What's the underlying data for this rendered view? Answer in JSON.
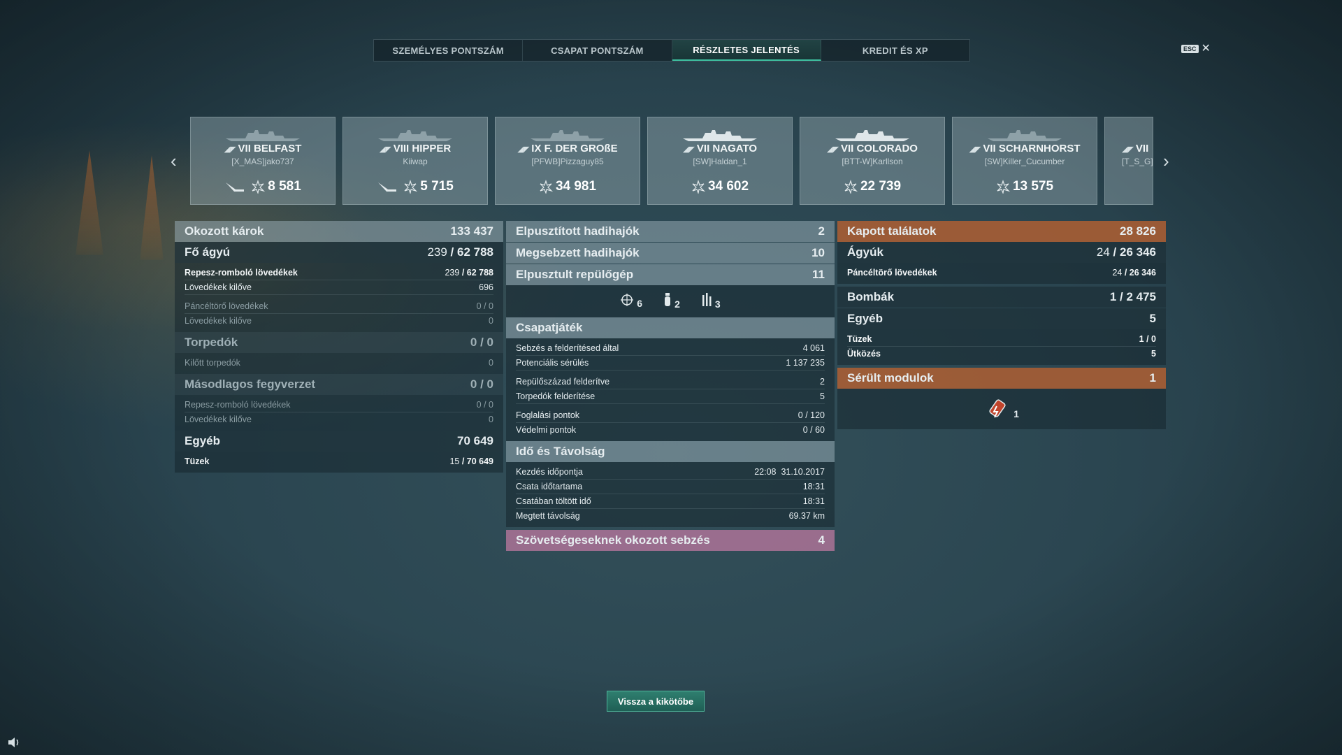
{
  "tabs": [
    {
      "label": "SZEMÉLYES PONTSZÁM"
    },
    {
      "label": "CSAPAT PONTSZÁM"
    },
    {
      "label": "RÉSZLETES JELENTÉS"
    },
    {
      "label": "KREDIT ÉS XP"
    }
  ],
  "esc": {
    "key": "ESC",
    "close": "✕"
  },
  "nav": {
    "prev": "‹",
    "next": "›"
  },
  "cards": [
    {
      "tier_name": "VII BELFAST",
      "player": "[X_MAS]jako737",
      "score": "8 581",
      "extra_icon": "plane-icon"
    },
    {
      "tier_name": "VIII HIPPER",
      "player": "Kiiwap",
      "score": "5 715",
      "extra_icon": "plane-icon"
    },
    {
      "tier_name": "IX F. DER GROßE",
      "player": "[PFWB]Pizzaguy85",
      "score": "34 981"
    },
    {
      "tier_name": "VII NAGATO",
      "player": "[SW]Haldan_1",
      "score": "34 602"
    },
    {
      "tier_name": "VII COLORADO",
      "player": "[BTT-W]Karllson",
      "score": "22 739"
    },
    {
      "tier_name": "VII SCHARNHORST",
      "player": "[SW]Killer_Cucumber",
      "score": "13 575"
    },
    {
      "tier_name": "VII",
      "player": "[T_S_G]",
      "score": ""
    }
  ],
  "left": {
    "damage_dealt": {
      "label": "Okozott károk",
      "value": "133 437"
    },
    "main_battery": {
      "label": "Fő ágyú",
      "value_a": "239",
      "value_b": "62 788"
    },
    "he_shells": {
      "label": "Repesz-romboló lövedékek",
      "value_a": "239",
      "value_b": "62 788"
    },
    "he_fired": {
      "label": "Lövedékek kilőve",
      "value": "696"
    },
    "ap_shells": {
      "label": "Páncéltörő lövedékek",
      "value": "0 / 0"
    },
    "ap_fired": {
      "label": "Lövedékek kilőve",
      "value": "0"
    },
    "torpedoes": {
      "label": "Torpedók",
      "value": "0 / 0"
    },
    "torp_fired": {
      "label": "Kilőtt torpedók",
      "value": "0"
    },
    "secondary": {
      "label": "Másodlagos fegyverzet",
      "value": "0 / 0"
    },
    "sec_he": {
      "label": "Repesz-romboló lövedékek",
      "value": "0 / 0"
    },
    "sec_fired": {
      "label": "Lövedékek kilőve",
      "value": "0"
    },
    "other": {
      "label": "Egyéb",
      "value": "70 649"
    },
    "fires": {
      "label": "Tüzek",
      "value_a": "15",
      "value_b": "70 649"
    }
  },
  "center": {
    "destroyed_ships": {
      "label": "Elpusztított hadihajók",
      "value": "2"
    },
    "damaged_ships": {
      "label": "Megsebzett hadihajók",
      "value": "10"
    },
    "destroyed_planes": {
      "label": "Elpusztult repülőgép",
      "value": "11"
    },
    "icons": {
      "crosshair": "6",
      "bomb": "2",
      "torpedo": "3"
    },
    "teamplay": {
      "label": "Csapatjáték"
    },
    "spot_damage": {
      "label": "Sebzés a felderítésed által",
      "value": "4 061"
    },
    "potential": {
      "label": "Potenciális sérülés",
      "value": "1 137 235"
    },
    "squadrons": {
      "label": "Repülőszázad felderítve",
      "value": "2"
    },
    "torps_spotted": {
      "label": "Torpedók felderítése",
      "value": "5"
    },
    "capture": {
      "label": "Foglalási pontok",
      "value": "0 / 120"
    },
    "defense": {
      "label": "Védelmi pontok",
      "value": "0 / 60"
    },
    "time_dist": {
      "label": "Idő és Távolság"
    },
    "start": {
      "label": "Kezdés időpontja",
      "time": "22:08",
      "date": "31.10.2017"
    },
    "duration": {
      "label": "Csata időtartama",
      "value": "18:31"
    },
    "time_in_battle": {
      "label": "Csatában töltött idő",
      "value": "18:31"
    },
    "distance": {
      "label": "Megtett távolság",
      "value": "69.37 km"
    },
    "ally_damage": {
      "label": "Szövetségeseknek okozott sebzés",
      "value": "4"
    }
  },
  "right": {
    "hits_received": {
      "label": "Kapott találatok",
      "value": "28 826"
    },
    "guns": {
      "label": "Ágyúk",
      "value_a": "24",
      "value_b": "26 346"
    },
    "ap": {
      "label": "Páncéltörő lövedékek",
      "value_a": "24",
      "value_b": "26 346"
    },
    "bombs": {
      "label": "Bombák",
      "value": "1 / 2 475"
    },
    "other": {
      "label": "Egyéb",
      "value": "5"
    },
    "fires": {
      "label": "Tüzek",
      "value": "1 / 0"
    },
    "collision": {
      "label": "Ütközés",
      "value": "5"
    },
    "damaged_modules": {
      "label": "Sérült modulok",
      "value": "1"
    },
    "module_count": "1"
  },
  "back_button": "Vissza a kikötőbe",
  "colors": {
    "accent": "#3ec0a0",
    "orange": "#af5f32",
    "pink": "#be78a0"
  }
}
